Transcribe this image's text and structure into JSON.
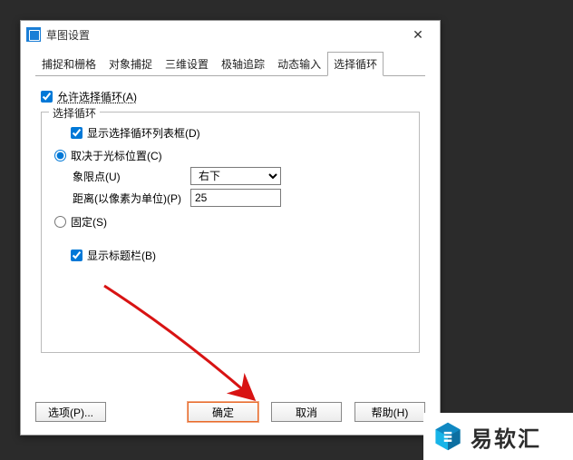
{
  "dialog": {
    "title": "草图设置",
    "tabs": [
      "捕捉和栅格",
      "对象捕捉",
      "三维设置",
      "极轴追踪",
      "动态输入",
      "选择循环"
    ],
    "activeTab": 5
  },
  "allowSelectCycle": {
    "label": "允许选择循环(A)",
    "checked": true
  },
  "group": {
    "legend": "选择循环",
    "showListBox": {
      "label": "显示选择循环列表框(D)",
      "checked": true
    },
    "radio": {
      "dependsCursor": "取决于光标位置(C)",
      "fixed": "固定(S)",
      "selected": "dependsCursor"
    },
    "quadrant": {
      "label": "象限点(U)",
      "value": "右下",
      "options": [
        "右下"
      ]
    },
    "distance": {
      "label": "距离(以像素为单位)(P)",
      "value": "25"
    },
    "showTitlebar": {
      "label": "显示标题栏(B)",
      "checked": true
    }
  },
  "buttons": {
    "options": "选项(P)...",
    "ok": "确定",
    "cancel": "取消",
    "help": "帮助(H)"
  },
  "brand": {
    "text": "易软汇"
  }
}
